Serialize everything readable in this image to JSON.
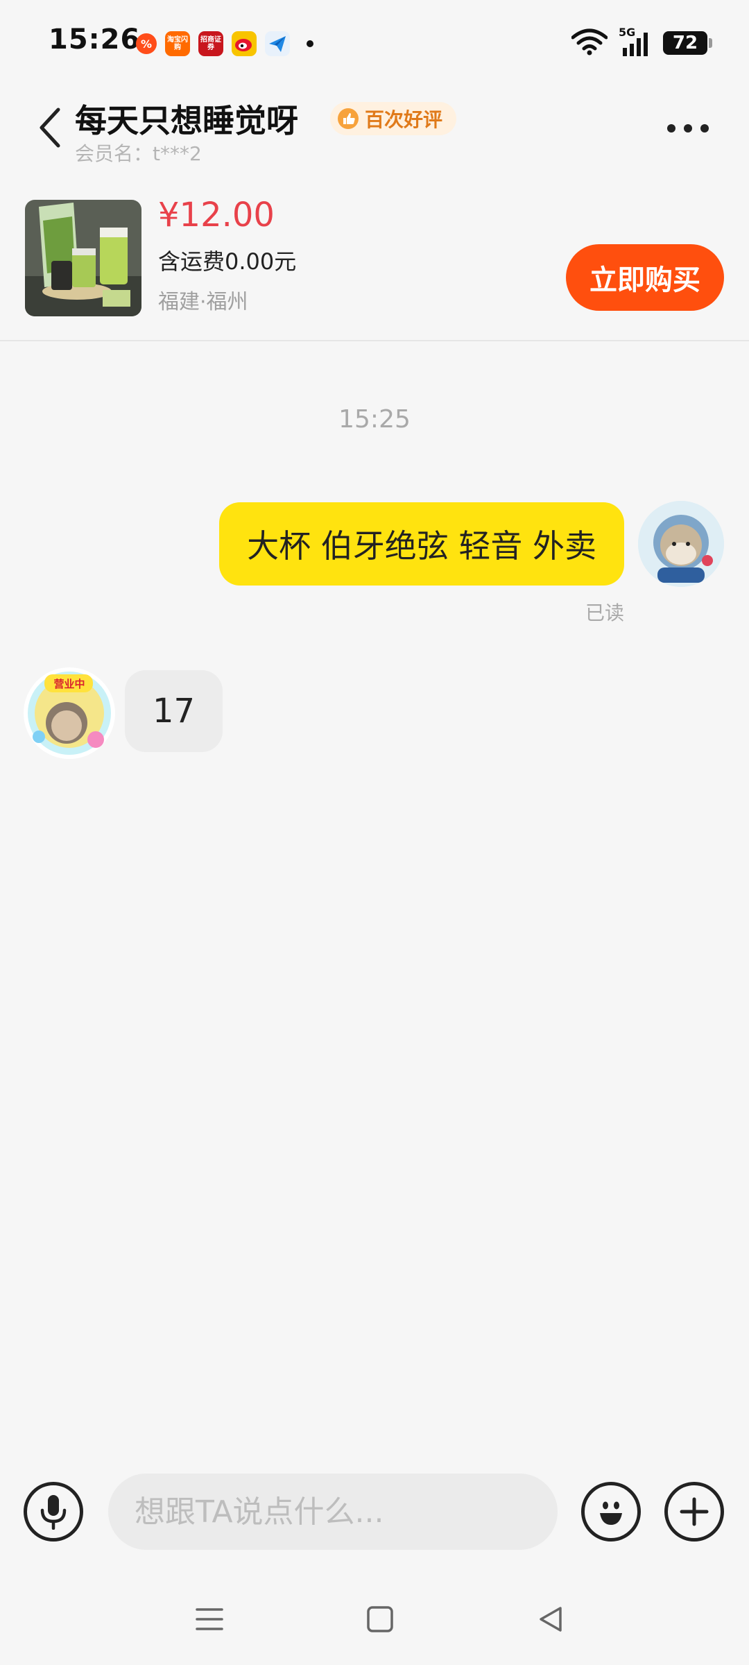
{
  "status_bar": {
    "time": "15:26",
    "apps": [
      {
        "icon": "app-icon-orange-circle",
        "label": "%",
        "color": "#ff4d1a"
      },
      {
        "icon": "taobao-shangou-icon",
        "label": "淘宝闪购",
        "color": "#ff6a00"
      },
      {
        "icon": "zhaoshang-zhengquan-icon",
        "label": "招商证券",
        "color": "#c8161d"
      },
      {
        "icon": "weibo-icon",
        "label": "",
        "color": "#f8c400"
      },
      {
        "icon": "paper-plane-app-icon",
        "label": "",
        "color": "#1e88e5"
      }
    ],
    "network": "5G",
    "battery": "72"
  },
  "header": {
    "seller_name": "每天只想睡觉呀",
    "badge": "百次好评",
    "member_name": "会员名：t***2"
  },
  "product": {
    "price": "¥12.00",
    "shipping": "含运费0.00元",
    "location": "福建·福州",
    "buy_label": "立即购买"
  },
  "chat": {
    "time": "15:25",
    "messages": [
      {
        "from": "me",
        "text": "大杯 伯牙绝弦 轻音 外卖",
        "status": "已读"
      },
      {
        "from": "seller",
        "text": "17"
      }
    ],
    "seller_avatar_text": "营业中"
  },
  "input": {
    "placeholder": "想跟TA说点什么..."
  },
  "colors": {
    "accent": "#ff4f0e",
    "price": "#e8414a",
    "my_bubble": "#ffe30f",
    "badge_text": "#e07a1a"
  }
}
